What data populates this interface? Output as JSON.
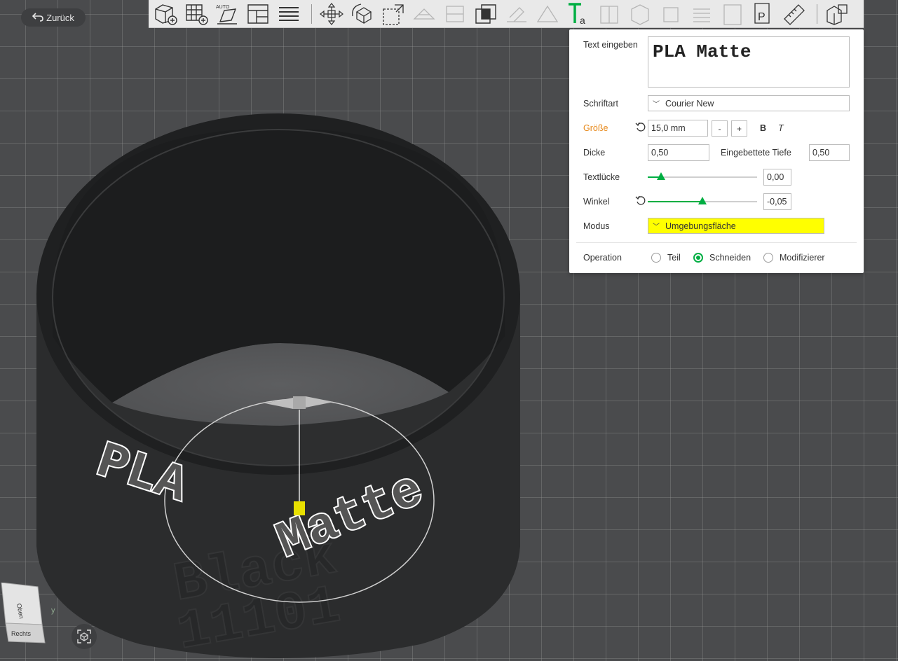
{
  "back": {
    "label": "Zurück"
  },
  "toolbar": {
    "icons": [
      "add-part-icon",
      "arrange-grid-icon",
      "auto-orient-icon",
      "layout-icon",
      "list-icon",
      "move-icon",
      "rotate-icon",
      "scale-icon",
      "text-tool-icon",
      "paint-icon",
      "measure-icon"
    ],
    "text_tool_badge": "a",
    "pin_badge": "P"
  },
  "panel": {
    "text_label": "Text eingeben",
    "text_value": "PLA Matte",
    "font_label": "Schriftart",
    "font_value": "Courier New",
    "size_label": "Größe",
    "size_value": "15,0 mm",
    "minus": "-",
    "plus": "+",
    "bold": "B",
    "italic": "T",
    "thickness_label": "Dicke",
    "thickness_value": "0,50",
    "embed_label": "Eingebettete Tiefe",
    "embed_value": "0,50",
    "gap_label": "Textlücke",
    "gap_value": "0,00",
    "gap_fraction": 0.12,
    "angle_label": "Winkel",
    "angle_value": "-0,05",
    "angle_fraction": 0.5,
    "mode_label": "Modus",
    "mode_value": "Umgebungsfläche",
    "mode_color": "#ffff00",
    "operation_label": "Operation",
    "operations": [
      "Teil",
      "Schneiden",
      "Modifizierer"
    ],
    "operation_selected": "Schneiden",
    "accent": "#00ae42",
    "size_label_color": "#e7891a"
  },
  "model": {
    "text_raised": "PLA Matte",
    "text_engraved_1": "Black",
    "text_engraved_2": "11101"
  },
  "viewcube": {
    "top_label": "Oben",
    "right_label": "Rechts",
    "axis_y": "y"
  }
}
